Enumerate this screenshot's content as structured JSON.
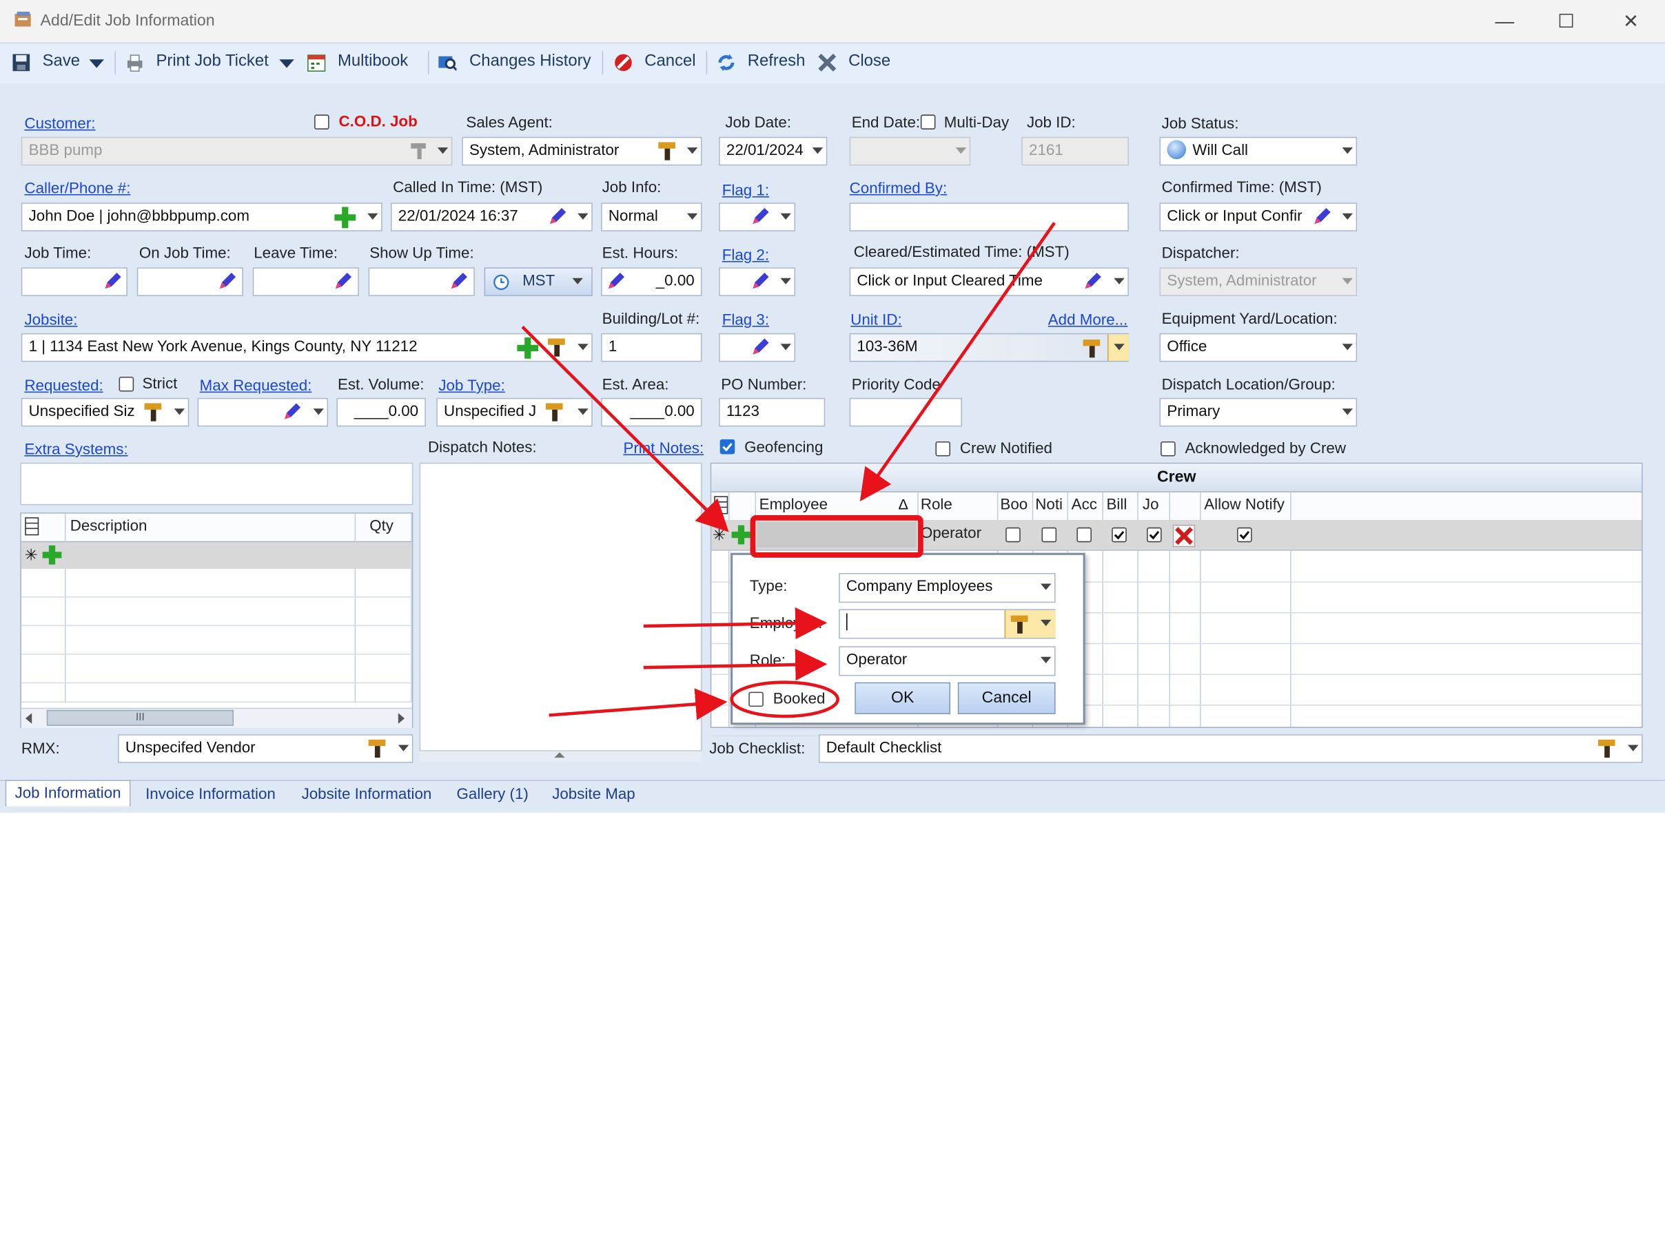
{
  "window": {
    "title": "Add/Edit Job Information",
    "controls": {
      "minimize": "—",
      "maximize": "☐",
      "close": "✕"
    }
  },
  "toolbar": {
    "save": "Save",
    "print_job_ticket": "Print Job Ticket",
    "multibook": "Multibook",
    "changes_history": "Changes History",
    "cancel": "Cancel",
    "refresh": "Refresh",
    "close": "Close"
  },
  "form": {
    "customer": {
      "label": "Customer:",
      "value": "BBB pump"
    },
    "cod": {
      "label": "C.O.D. Job",
      "checked": false
    },
    "sales_agent": {
      "label": "Sales Agent:",
      "value": "System, Administrator"
    },
    "job_date": {
      "label": "Job Date:",
      "value": "22/01/2024"
    },
    "end_date": {
      "label": "End Date:",
      "value": ""
    },
    "multi_day": {
      "label": "Multi-Day",
      "checked": false
    },
    "job_id": {
      "label": "Job ID:",
      "value": "2161"
    },
    "job_status": {
      "label": "Job Status:",
      "value": "Will Call"
    },
    "caller": {
      "label": "Caller/Phone #:",
      "value": "John Doe | john@bbbpump.com"
    },
    "called_in": {
      "label": "Called In Time: (MST)",
      "value": "22/01/2024 16:37"
    },
    "job_info": {
      "label": "Job Info:",
      "value": "Normal"
    },
    "flag1": {
      "label": "Flag 1:"
    },
    "confirmed_by": {
      "label": "Confirmed By:",
      "value": ""
    },
    "confirmed_time": {
      "label": "Confirmed Time: (MST)",
      "value": "Click or Input Confir"
    },
    "job_time": {
      "label": "Job Time:"
    },
    "on_job_time": {
      "label": "On Job Time:"
    },
    "leave_time": {
      "label": "Leave Time:"
    },
    "show_up_time": {
      "label": "Show Up Time:"
    },
    "tz": {
      "value": "MST"
    },
    "est_hours": {
      "label": "Est. Hours:",
      "value": "_0.00"
    },
    "flag2": {
      "label": "Flag 2:"
    },
    "cleared_time": {
      "label": "Cleared/Estimated Time: (MST)",
      "value": "Click or Input Cleared Time"
    },
    "dispatcher": {
      "label": "Dispatcher:",
      "value": "System, Administrator"
    },
    "jobsite": {
      "label": "Jobsite:",
      "value": "1 | 1134 East New York Avenue, Kings County, NY 11212"
    },
    "building_lot": {
      "label": "Building/Lot #:",
      "value": "1"
    },
    "flag3": {
      "label": "Flag 3:"
    },
    "unit_id": {
      "label": "Unit ID:",
      "value": "103-36M",
      "add_more": "Add More..."
    },
    "equipment_yard": {
      "label": "Equipment Yard/Location:",
      "value": "Office"
    },
    "requested": {
      "label": "Requested:",
      "value": "Unspecified Siz"
    },
    "strict": {
      "label": "Strict",
      "checked": false
    },
    "max_requested": {
      "label": "Max Requested:"
    },
    "est_volume": {
      "label": "Est. Volume:",
      "value": "____0.00"
    },
    "job_type": {
      "label": "Job Type:",
      "value": "Unspecified J"
    },
    "est_area": {
      "label": "Est. Area:",
      "value": "____0.00"
    },
    "po_number": {
      "label": "PO Number:",
      "value": "1123"
    },
    "priority_code": {
      "label": "Priority Code",
      "value": ""
    },
    "dispatch_location": {
      "label": "Dispatch Location/Group:",
      "value": "Primary"
    },
    "extra_systems": {
      "label": "Extra Systems:"
    },
    "dispatch_notes": {
      "label": "Dispatch Notes:"
    },
    "print_notes": {
      "label": "Print Notes:"
    },
    "geofencing": {
      "label": "Geofencing",
      "checked": true
    },
    "crew_notified": {
      "label": "Crew Notified",
      "checked": false
    },
    "acknowledged": {
      "label": "Acknowledged by Crew",
      "checked": false
    },
    "rmx": {
      "label": "RMX:",
      "value": "Unspecifed Vendor"
    },
    "job_checklist": {
      "label": "Job Checklist:",
      "value": "Default Checklist"
    }
  },
  "extra_grid": {
    "columns": [
      "Description",
      "Qty"
    ],
    "scroll_thumb": "III"
  },
  "crew": {
    "title": "Crew",
    "columns": [
      "Employee",
      "Role",
      "Boo",
      "Noti",
      "Acc",
      "Bill",
      "Jo",
      "Allow Notify"
    ],
    "sort_indicator": "Δ",
    "new_row": {
      "role": "Operator",
      "boo": false,
      "noti": false,
      "acc": false,
      "bill": true,
      "jo": true,
      "allow_notify": true
    }
  },
  "popup": {
    "type_label": "Type:",
    "type_value": "Company Employees",
    "employee_label": "Employee:",
    "employee_value": "",
    "role_label": "Role:",
    "role_value": "Operator",
    "booked_label": "Booked",
    "booked_checked": false,
    "ok": "OK",
    "cancel": "Cancel"
  },
  "tabs": [
    "Job Information",
    "Invoice Information",
    "Jobsite Information",
    "Gallery (1)",
    "Jobsite Map"
  ],
  "colors": {
    "accent": "#1a47d4",
    "annotation": "#e8121b",
    "toolbar": "#e5effc",
    "panel": "#dfe9f6"
  }
}
